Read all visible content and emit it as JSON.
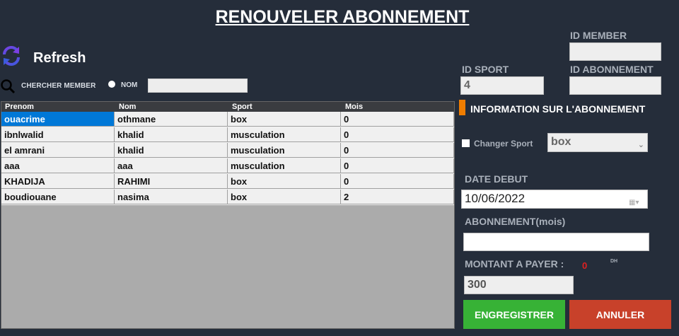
{
  "page_title": "RENOUVELER ABONNEMENT",
  "refresh": {
    "label": "Refresh",
    "icon": "refresh-icon"
  },
  "search": {
    "label": "CHERCHER MEMBER",
    "radio_label": "NOM",
    "value": ""
  },
  "grid": {
    "columns": [
      "Prenom",
      "Nom",
      "Sport",
      "Mois"
    ],
    "rows": [
      [
        "ouacrime",
        "othmane",
        "box",
        "0"
      ],
      [
        "ibnlwalid",
        "khalid",
        "musculation",
        "0"
      ],
      [
        "el amrani",
        "khalid",
        "musculation",
        "0"
      ],
      [
        "aaa",
        "aaa",
        "musculation",
        "0"
      ],
      [
        "KHADIJA",
        "RAHIMI",
        "box",
        "0"
      ],
      [
        "boudiouane",
        "nasima",
        "box",
        "2"
      ]
    ]
  },
  "form": {
    "id_member_label": "ID MEMBER",
    "id_member_value": "",
    "id_sport_label": "ID SPORT",
    "id_sport_value": "4",
    "id_abonnement_label": "ID ABONNEMENT",
    "id_abonnement_value": "",
    "section_title": "INFORMATION SUR L'ABONNEMENT",
    "change_sport_label": "Changer Sport",
    "sport_selected": "box",
    "date_debut_label": "DATE DEBUT",
    "date_debut_value": "10/06/2022",
    "abonnement_label": "ABONNEMENT(mois)",
    "abonnement_value": "",
    "montant_label": "MONTANT A PAYER :",
    "montant_value": "0",
    "currency": "DH",
    "price_value": "300"
  },
  "buttons": {
    "save": "ENGREGISTRER",
    "cancel": "ANNULER"
  },
  "colors": {
    "background": "#252d3a",
    "selection": "#0078d7",
    "accent": "#f07d00",
    "save": "#37b236",
    "cancel": "#c8412a"
  }
}
